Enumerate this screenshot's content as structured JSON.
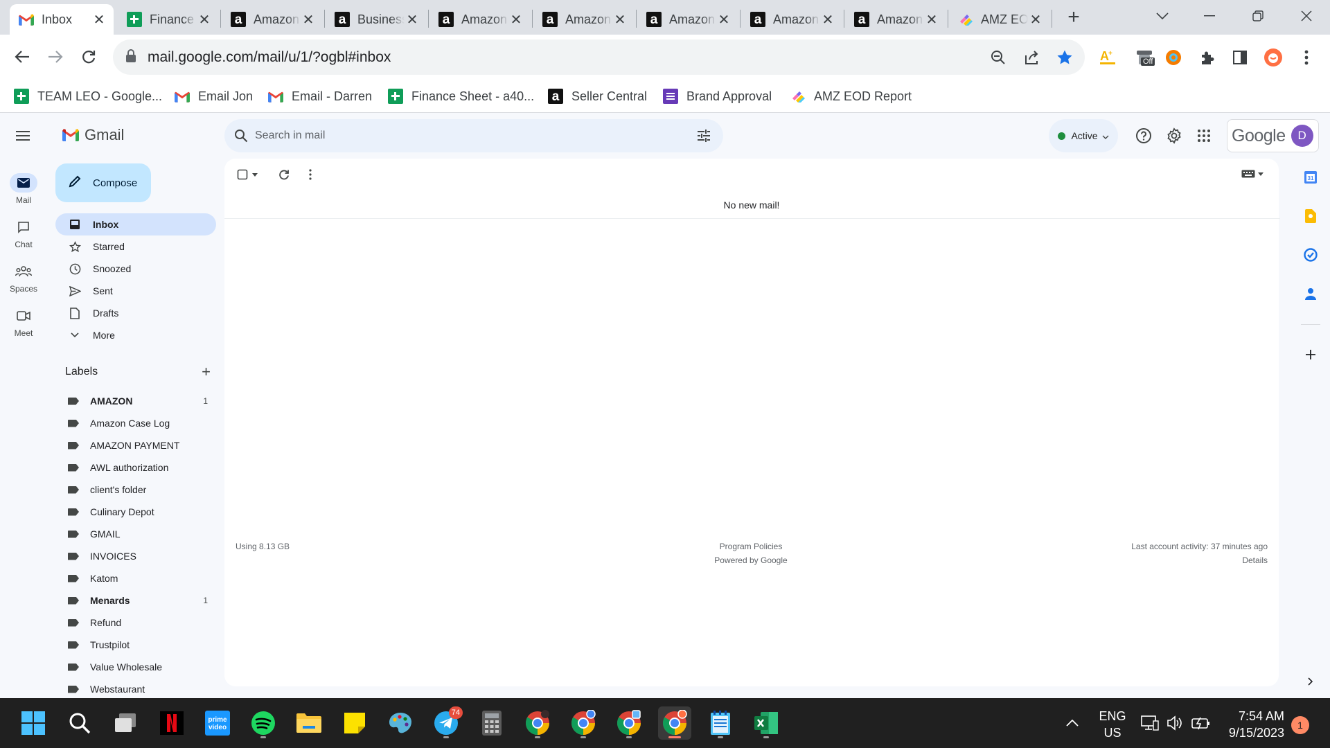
{
  "browser": {
    "tabs": [
      {
        "title": "Inbox",
        "icon": "gmail-icon",
        "active": true
      },
      {
        "title": "Finance",
        "icon": "sheets-icon"
      },
      {
        "title": "Amazon",
        "icon": "amazon-icon"
      },
      {
        "title": "Business",
        "icon": "amazon-icon"
      },
      {
        "title": "Amazon",
        "icon": "amazon-icon"
      },
      {
        "title": "Amazon",
        "icon": "amazon-icon"
      },
      {
        "title": "Amazon",
        "icon": "amazon-icon"
      },
      {
        "title": "Amazon",
        "icon": "amazon-icon"
      },
      {
        "title": "Amazon",
        "icon": "amazon-icon"
      },
      {
        "title": "AMZ EOD",
        "icon": "clickup-icon"
      }
    ],
    "url": "mail.google.com/mail/u/1/?ogbl#inbox",
    "extension_off_label": "Off",
    "bookmarks": [
      {
        "label": "TEAM LEO - Google...",
        "icon": "sheets-icon"
      },
      {
        "label": "Email Jon",
        "icon": "gmail-icon"
      },
      {
        "label": "Email - Darren",
        "icon": "gmail-icon"
      },
      {
        "label": "Finance Sheet - a40...",
        "icon": "sheets-icon"
      },
      {
        "label": "Seller Central",
        "icon": "amazon-icon"
      },
      {
        "label": "Brand Approval",
        "icon": "forms-icon"
      },
      {
        "label": "AMZ EOD Report",
        "icon": "clickup-icon"
      }
    ]
  },
  "gmail": {
    "app_name": "Gmail",
    "rail": [
      {
        "label": "Mail",
        "icon": "mail-icon",
        "active": true
      },
      {
        "label": "Chat",
        "icon": "chat-icon"
      },
      {
        "label": "Spaces",
        "icon": "spaces-icon"
      },
      {
        "label": "Meet",
        "icon": "meet-icon"
      }
    ],
    "search_placeholder": "Search in mail",
    "status": "Active",
    "account_brand": "Google",
    "avatar_initial": "D",
    "compose_label": "Compose",
    "nav": [
      {
        "label": "Inbox",
        "icon": "inbox-icon",
        "active": true
      },
      {
        "label": "Starred",
        "icon": "star-icon"
      },
      {
        "label": "Snoozed",
        "icon": "clock-icon"
      },
      {
        "label": "Sent",
        "icon": "send-icon"
      },
      {
        "label": "Drafts",
        "icon": "draft-icon"
      },
      {
        "label": "More",
        "icon": "chevron-down-icon"
      }
    ],
    "labels_title": "Labels",
    "labels": [
      {
        "name": "AMAZON",
        "count": "1",
        "bold": true
      },
      {
        "name": "Amazon Case Log",
        "count": ""
      },
      {
        "name": "AMAZON PAYMENT",
        "count": ""
      },
      {
        "name": "AWL authorization",
        "count": ""
      },
      {
        "name": "client's folder",
        "count": ""
      },
      {
        "name": "Culinary Depot",
        "count": ""
      },
      {
        "name": "GMAIL",
        "count": ""
      },
      {
        "name": "INVOICES",
        "count": ""
      },
      {
        "name": "Katom",
        "count": ""
      },
      {
        "name": "Menards",
        "count": "1",
        "bold": true
      },
      {
        "name": "Refund",
        "count": ""
      },
      {
        "name": "Trustpilot",
        "count": ""
      },
      {
        "name": "Value Wholesale",
        "count": ""
      },
      {
        "name": "Webstaurant",
        "count": ""
      }
    ],
    "empty_message": "No new mail!",
    "footer": {
      "storage": "Using 8.13 GB",
      "policies": "Program Policies",
      "powered": "Powered by Google",
      "last_activity": "Last account activity: 37 minutes ago",
      "details": "Details"
    }
  },
  "taskbar": {
    "telegram_badge": "74",
    "lang_line1": "ENG",
    "lang_line2": "US",
    "time": "7:54 AM",
    "date": "9/15/2023",
    "notification_count": "1"
  },
  "colors": {
    "gmail_bg": "#f6f8fc",
    "active_nav": "#d3e3fd",
    "compose": "#c2e7ff",
    "taskbar": "#202020"
  }
}
